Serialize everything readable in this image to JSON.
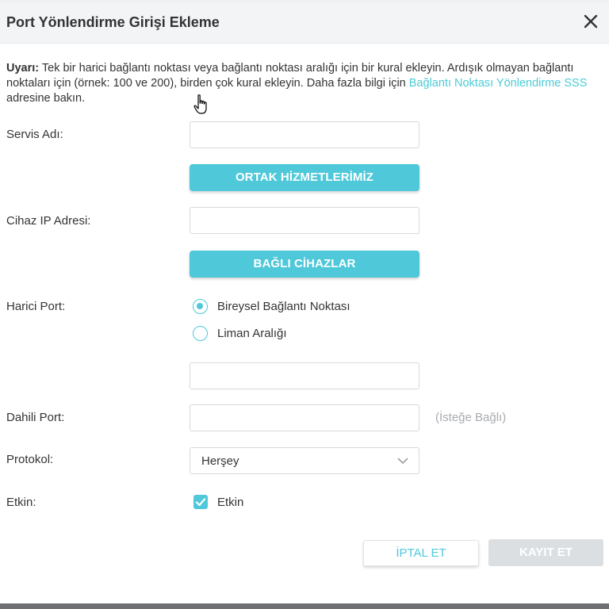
{
  "dialog": {
    "title": "Port Yönlendirme Girişi Ekleme",
    "close_icon": "close-icon"
  },
  "warning": {
    "bold": "Uyarı:",
    "text": " Tek bir harici bağlantı noktası veya bağlantı noktası aralığı için bir kural ekleyin. Ardışık olmayan bağlantı noktaları için (örnek: 100 ve 200), birden çok kural ekleyin. Daha fazla bilgi için ",
    "link": "Bağlantı Noktası Yönlendirme SSS",
    "suffix": " adresine bakın."
  },
  "form": {
    "service_name": {
      "label": "Servis Adı:",
      "value": ""
    },
    "common_services_button": "ORTAK HİZMETLERİMİZ",
    "device_ip": {
      "label": "Cihaz IP Adresi:",
      "value": ""
    },
    "connected_devices_button": "BAĞLI CİHAZLAR",
    "external_port": {
      "label": "Harici Port:",
      "options": [
        {
          "label": "Bireysel Bağlantı Noktası",
          "selected": true
        },
        {
          "label": "Liman Aralığı",
          "selected": false
        }
      ],
      "value": ""
    },
    "internal_port": {
      "label": "Dahili Port:",
      "value": "",
      "hint": "(İsteğe Bağlı)"
    },
    "protocol": {
      "label": "Protokol:",
      "selected": "Herşey"
    },
    "enabled": {
      "label": "Etkin:",
      "checkbox_label": "Etkin",
      "checked": true
    }
  },
  "footer": {
    "cancel": "İPTAL ET",
    "save": "KAYIT ET"
  },
  "colors": {
    "accent": "#4fc8d9",
    "disabled": "#dcdfe2",
    "link": "#4acbd6"
  }
}
